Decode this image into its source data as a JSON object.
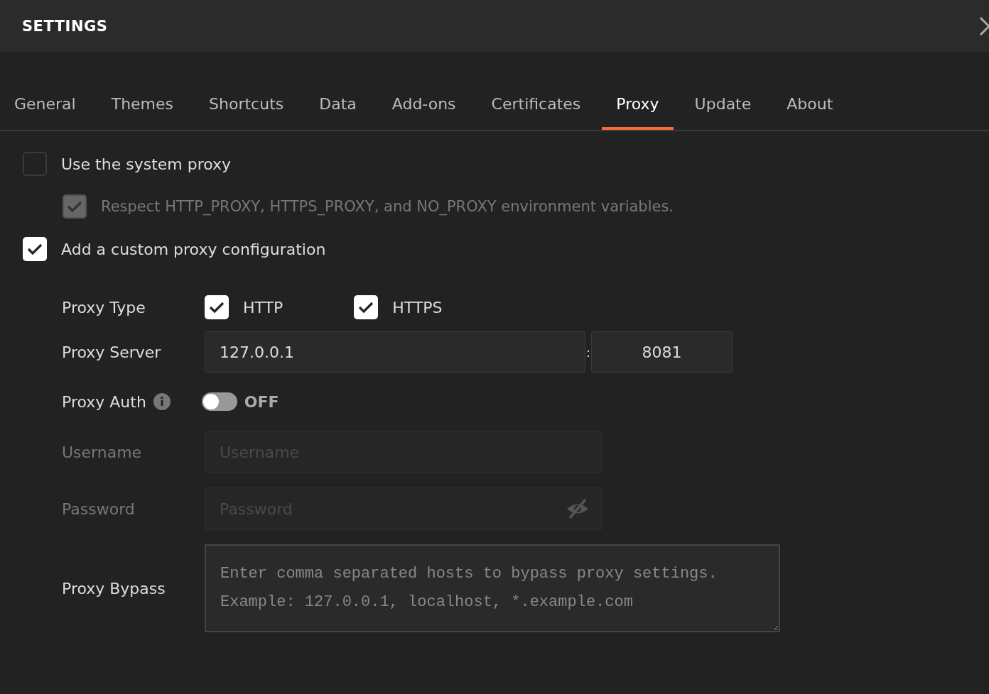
{
  "header": {
    "title": "SETTINGS"
  },
  "tabs": [
    {
      "label": "General",
      "selected": false
    },
    {
      "label": "Themes",
      "selected": false
    },
    {
      "label": "Shortcuts",
      "selected": false
    },
    {
      "label": "Data",
      "selected": false
    },
    {
      "label": "Add-ons",
      "selected": false
    },
    {
      "label": "Certificates",
      "selected": false
    },
    {
      "label": "Proxy",
      "selected": true
    },
    {
      "label": "Update",
      "selected": false
    },
    {
      "label": "About",
      "selected": false
    }
  ],
  "options": [
    {
      "label": "Use the system proxy",
      "checked": false,
      "disabled": false,
      "children": [
        {
          "label": "Respect HTTP_PROXY, HTTPS_PROXY, and NO_PROXY environment variables.",
          "checked": true,
          "disabled": true
        }
      ]
    },
    {
      "label": "Add a custom proxy configuration",
      "checked": true,
      "disabled": false
    }
  ],
  "proxy_type": {
    "label": "Proxy Type",
    "options": [
      {
        "label": "HTTP",
        "checked": true
      },
      {
        "label": "HTTPS",
        "checked": true
      }
    ]
  },
  "proxy_server": {
    "label": "Proxy Server",
    "host": "127.0.0.1",
    "separator": ":",
    "port": "8081"
  },
  "proxy_auth": {
    "label": "Proxy Auth",
    "on": false,
    "state_text": "OFF"
  },
  "username": {
    "label": "Username",
    "placeholder": "Username",
    "disabled": true
  },
  "password": {
    "label": "Password",
    "placeholder": "Password",
    "disabled": true
  },
  "proxy_bypass": {
    "label": "Proxy Bypass",
    "placeholder": "Enter comma separated hosts to bypass proxy settings.\nExample: 127.0.0.1, localhost, *.example.com"
  }
}
